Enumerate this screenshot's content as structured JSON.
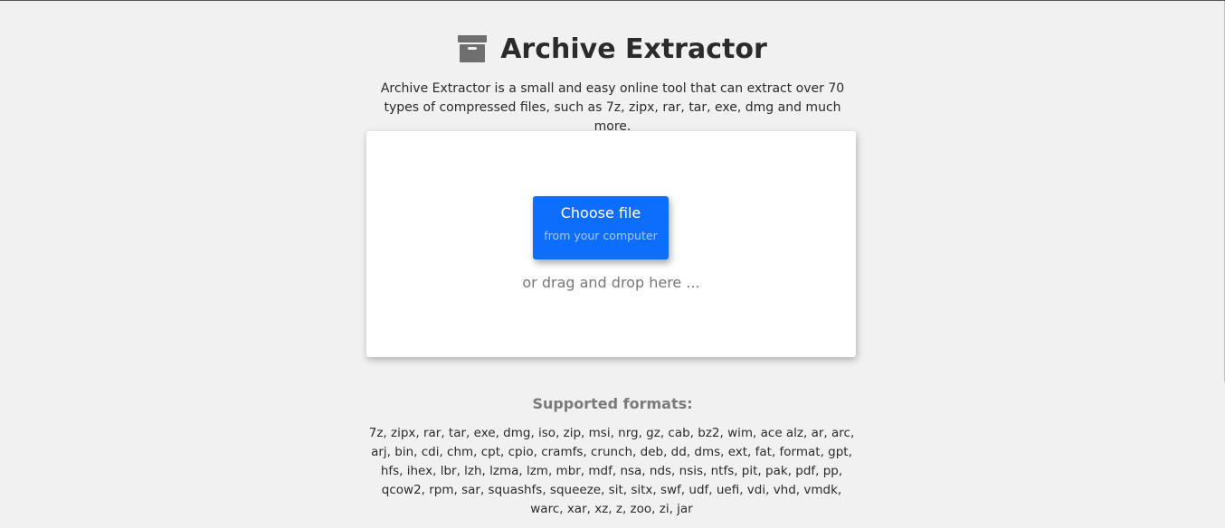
{
  "header": {
    "title": "Archive Extractor",
    "icon": "archive-box-icon"
  },
  "description": "Archive Extractor is a small and easy online tool that can extract over 70 types of compressed files, such as 7z, zipx, rar, tar, exe, dmg and much more.",
  "dropzone": {
    "button_label": "Choose file",
    "button_sublabel": "from your computer",
    "drag_hint": "or drag and drop here ..."
  },
  "formats": {
    "heading": "Supported formats:",
    "list": "7z, zipx, rar, tar, exe, dmg, iso, zip, msi, nrg, gz, cab, bz2, wim, ace alz, ar, arc, arj, bin, cdi, chm, cpt, cpio, cramfs, crunch, deb, dd, dms, ext, fat, format, gpt, hfs, ihex, lbr, lzh, lzma, lzm, mbr, mdf, nsa, nds, nsis, ntfs, pit, pak, pdf, pp, qcow2, rpm, sar, squashfs, squeeze, sit, sitx, swf, udf, uefi, vdi, vhd, vmdk, warc, xar, xz, z, zoo, zi, jar"
  },
  "colors": {
    "accent": "#0d6efd",
    "background": "#f1f1f1",
    "icon": "#6f6f6f"
  }
}
